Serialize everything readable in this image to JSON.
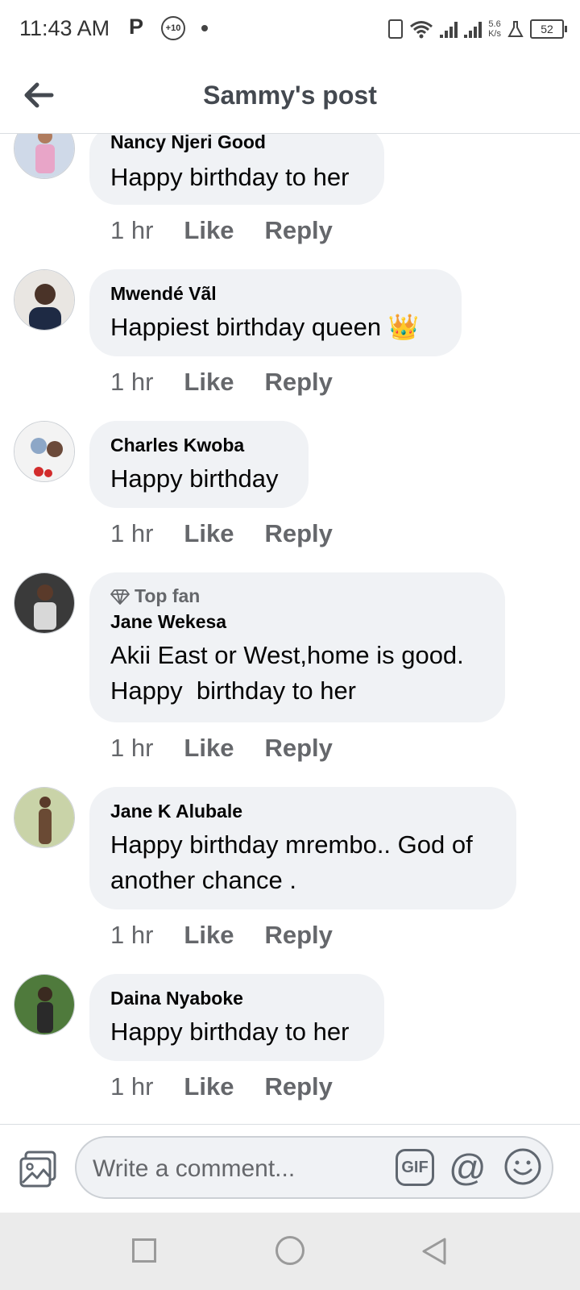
{
  "status_bar": {
    "time": "11:43 AM",
    "p_label": "P",
    "badge_label": "+10",
    "speed_top": "5.6",
    "speed_unit": "K/s",
    "battery": "52"
  },
  "header": {
    "title": "Sammy's post"
  },
  "comments": [
    {
      "name": "Nancy Njeri Good",
      "text": "Happy birthday to her",
      "time": "1 hr",
      "like": "Like",
      "reply": "Reply"
    },
    {
      "name": "Mwendé Vãl",
      "text": "Happiest birthday queen 👑",
      "time": "1 hr",
      "like": "Like",
      "reply": "Reply"
    },
    {
      "name": "Charles Kwoba",
      "text": "Happy birthday",
      "time": "1 hr",
      "like": "Like",
      "reply": "Reply"
    },
    {
      "badge": "Top fan",
      "name": "Jane Wekesa",
      "text": "Akii East or West,home is good.",
      "text2": "Happy  birthday to her",
      "time": "1 hr",
      "like": "Like",
      "reply": "Reply"
    },
    {
      "name": "Jane K Alubale",
      "text": "Happy birthday mrembo.. God of",
      "text2": "another chance .",
      "time": "1 hr",
      "like": "Like",
      "reply": "Reply"
    },
    {
      "name": "Daina Nyaboke",
      "text": "Happy birthday to her",
      "time": "1 hr",
      "like": "Like",
      "reply": "Reply"
    }
  ],
  "composer": {
    "placeholder": "Write a comment...",
    "gif_label": "GIF",
    "mention_label": "@"
  },
  "colors": {
    "bubble": "#f0f2f5",
    "meta_text": "#65676b",
    "nav_bar": "#ebebeb"
  }
}
